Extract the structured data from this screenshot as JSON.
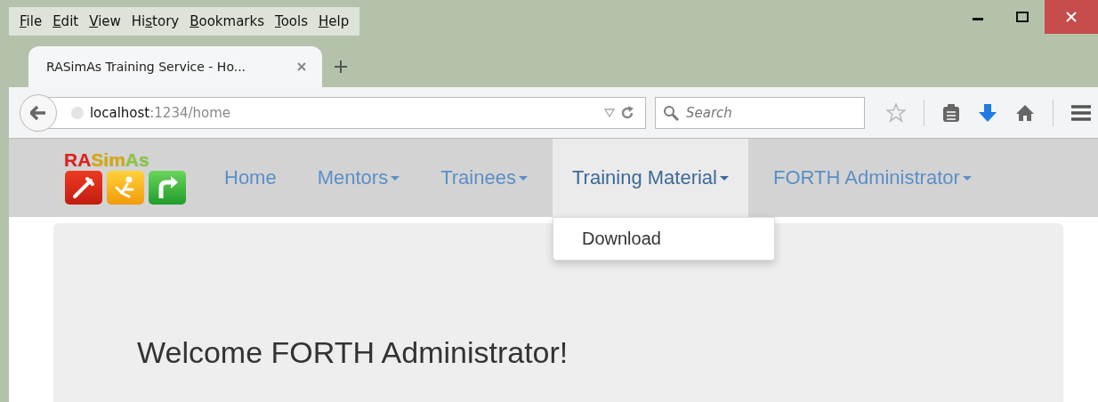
{
  "menu_bar": [
    {
      "key": "F",
      "after": "ile"
    },
    {
      "key": "E",
      "after": "dit"
    },
    {
      "key": "V",
      "after": "iew"
    },
    {
      "before": "Hi",
      "key": "s",
      "after": "tory"
    },
    {
      "key": "B",
      "after": "ookmarks"
    },
    {
      "key": "T",
      "after": "ools"
    },
    {
      "key": "H",
      "after": "elp"
    }
  ],
  "tabs": [
    {
      "title": "RASimAs Training Service - Ho...",
      "selected": true
    }
  ],
  "address_bar": {
    "host": "localhost",
    "rest": ":1234/home"
  },
  "search": {
    "placeholder": "Search"
  },
  "logo": {
    "parts": [
      {
        "text": "RA",
        "color": "#e0201c"
      },
      {
        "text": "Sim",
        "color": "#d9a800"
      },
      {
        "text": "As",
        "color": "#8cc63e"
      }
    ]
  },
  "nav": [
    {
      "label": "Home",
      "dropdown": false,
      "selected": false
    },
    {
      "label": "Mentors",
      "dropdown": true,
      "selected": false
    },
    {
      "label": "Trainees",
      "dropdown": true,
      "selected": false
    },
    {
      "label": "Training Material",
      "dropdown": true,
      "selected": true,
      "menu": [
        "Download"
      ]
    },
    {
      "label": "FORTH Administrator",
      "dropdown": true,
      "selected": false
    }
  ],
  "heading": "Welcome FORTH Administrator!"
}
